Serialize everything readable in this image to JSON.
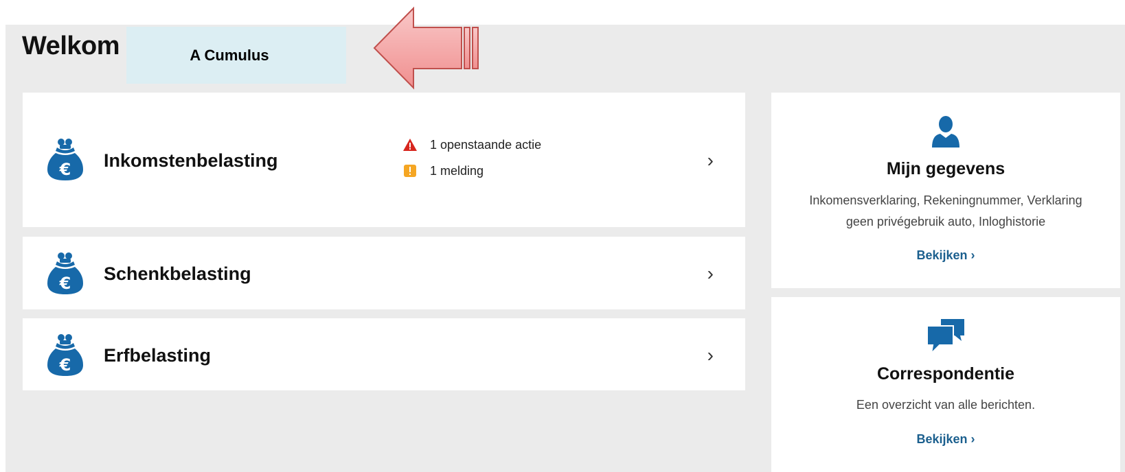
{
  "header": {
    "title": "Welkom"
  },
  "annotation": {
    "name": "A Cumulus"
  },
  "taxes": [
    {
      "title": "Inkomstenbelasting",
      "icon": "money-bag-euro-icon",
      "alerts": [
        {
          "icon": "warning-triangle-icon",
          "text": "1 openstaande actie"
        },
        {
          "icon": "exclamation-square-icon",
          "text": "1 melding"
        }
      ]
    },
    {
      "title": "Schenkbelasting",
      "icon": "money-bag-euro-icon"
    },
    {
      "title": "Erfbelasting",
      "icon": "money-bag-euro-icon"
    }
  ],
  "chevron": "›",
  "side_cards": [
    {
      "icon": "person-icon",
      "title": "Mijn gegevens",
      "description_line1": "Inkomensverklaring, Rekeningnummer, Verklaring",
      "description_line2": "geen privégebruik auto, Inloghistorie",
      "link": "Bekijken ›"
    },
    {
      "icon": "speech-bubbles-icon",
      "title": "Correspondentie",
      "description_line1": "Een overzicht van alle berichten.",
      "link": "Bekijken ›"
    }
  ],
  "colors": {
    "background": "#ebebeb",
    "brand_blue": "#1769a9",
    "link_blue": "#1b5f8e",
    "warning_red": "#d7261e",
    "notice_yellow": "#f5a623",
    "arrow_fill": "#f4a3a3",
    "arrow_stroke": "#c0504d",
    "name_box": "#dceef3"
  }
}
